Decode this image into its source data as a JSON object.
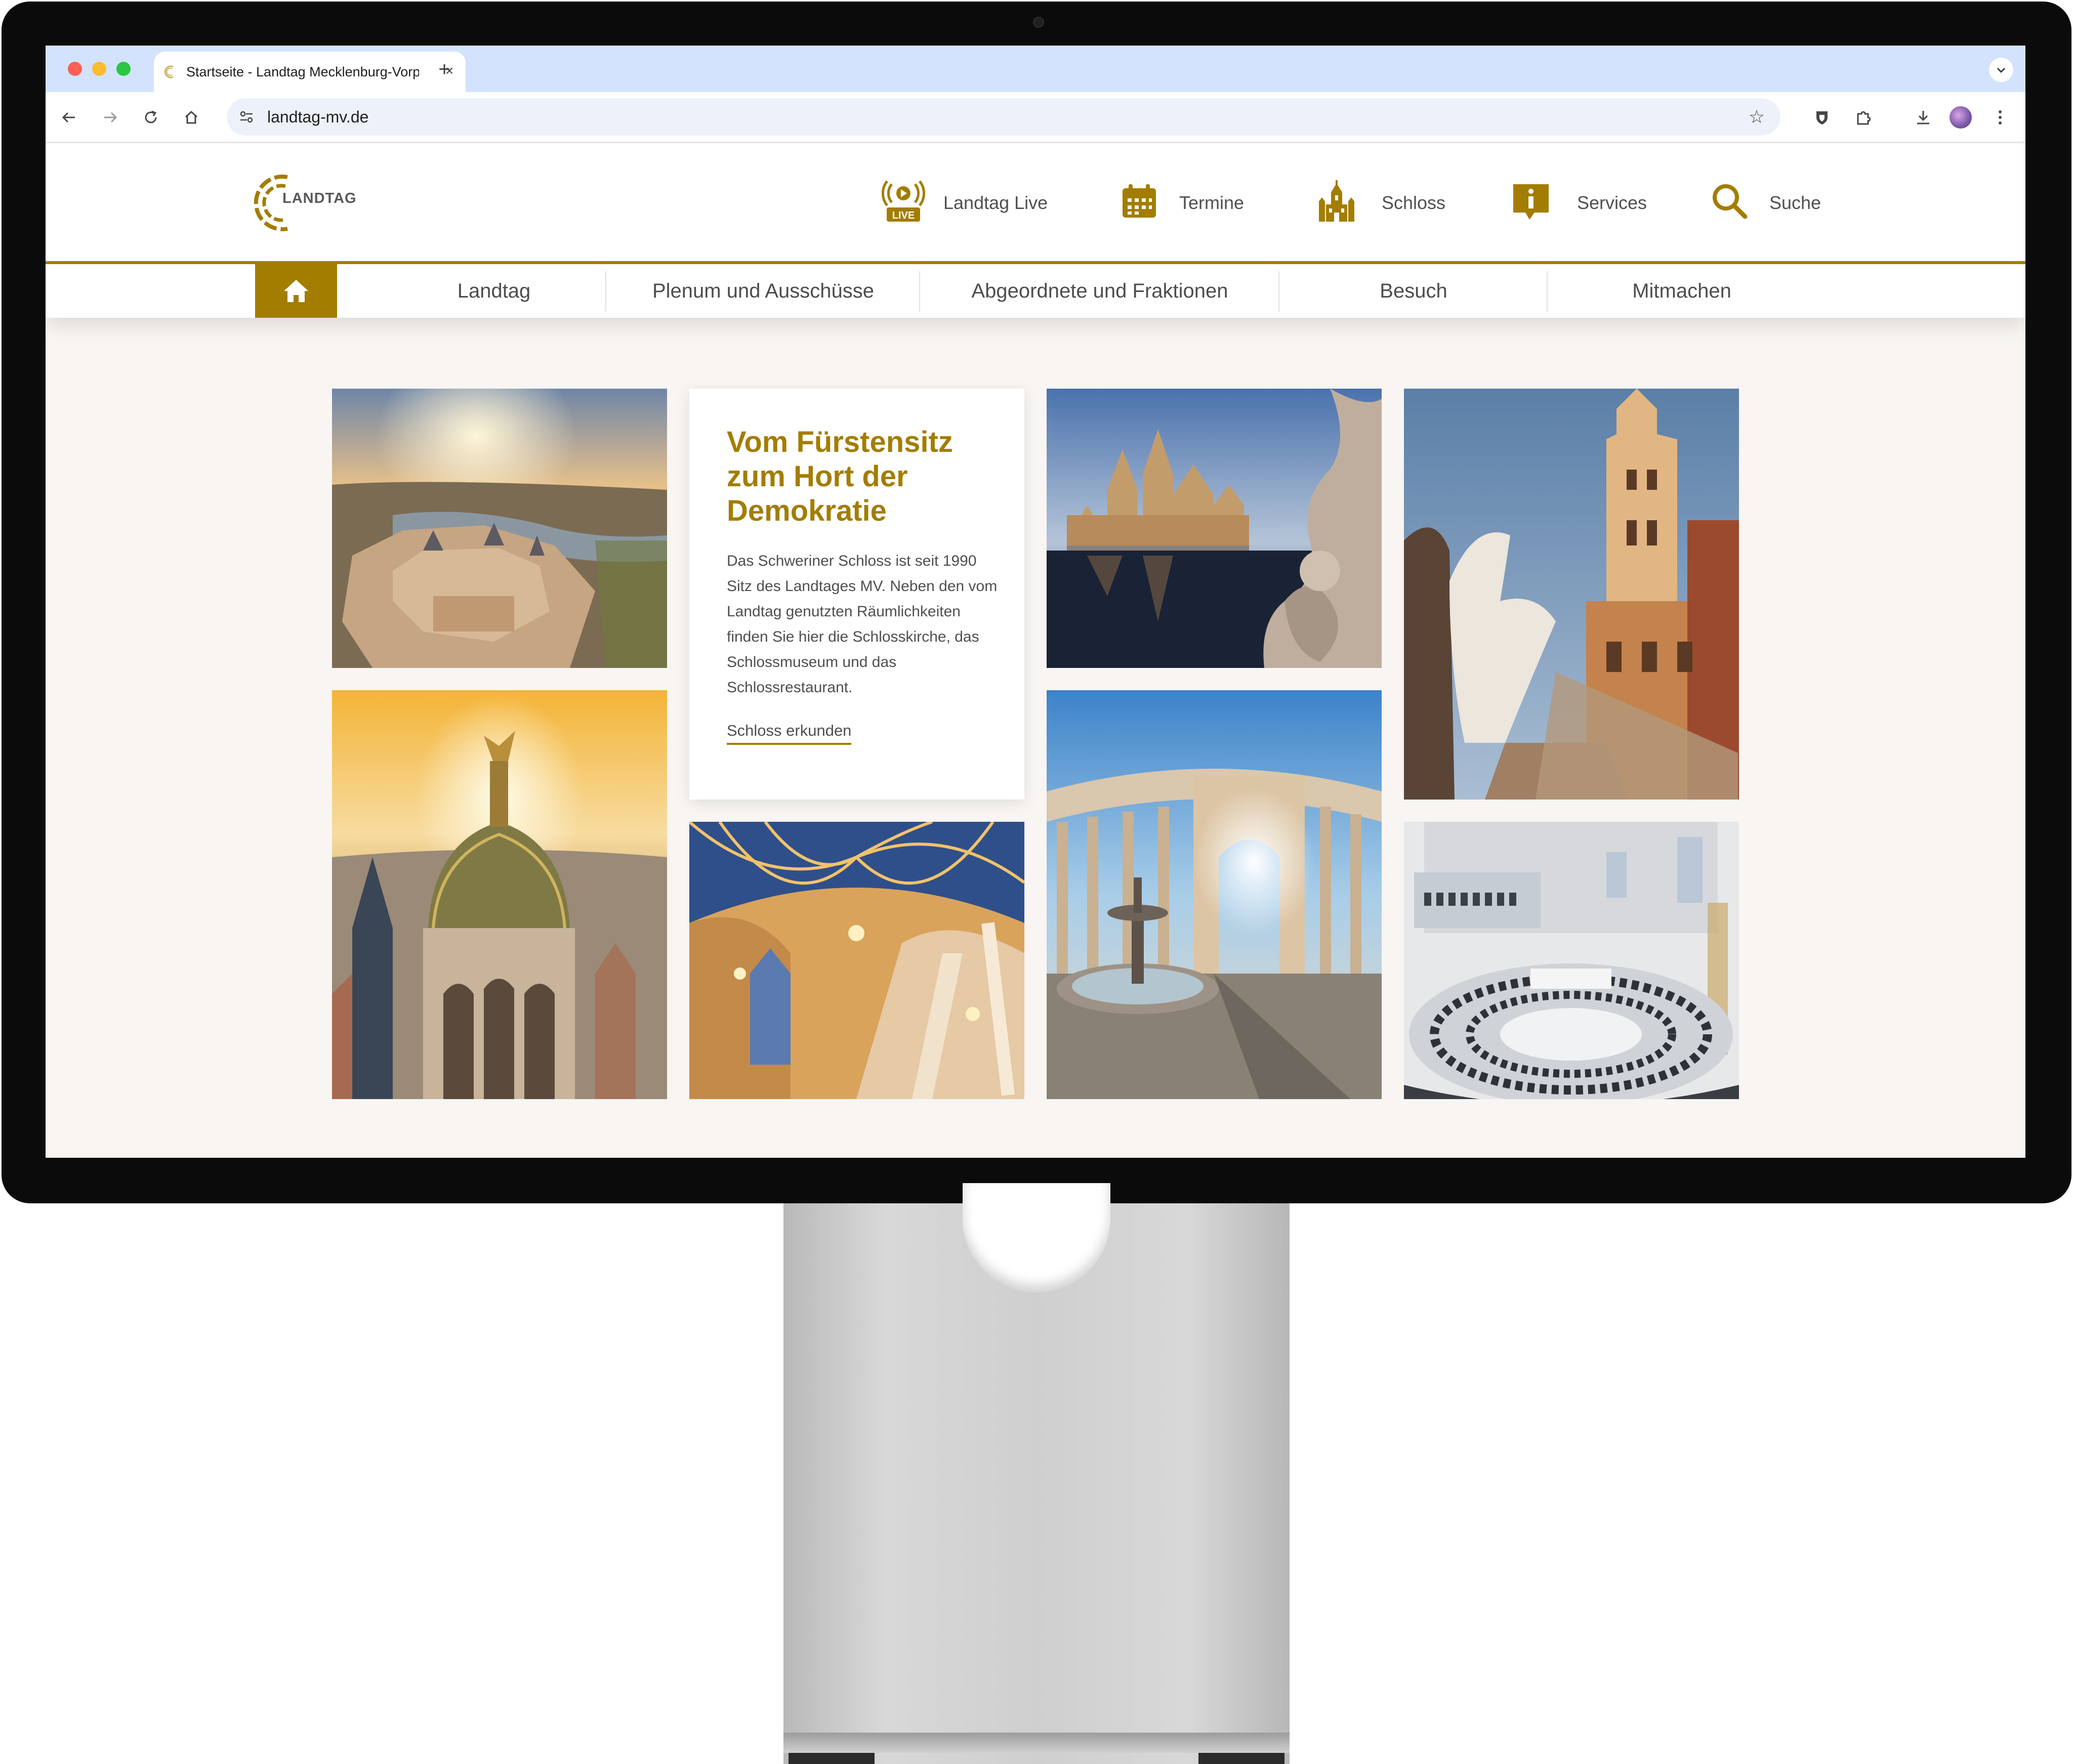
{
  "browser": {
    "tab_title": "Startseite - Landtag Mecklenburg-Vorpommern",
    "tab_close": "×",
    "new_tab": "+",
    "url": "landtag-mv.de"
  },
  "header": {
    "logo_text": "LANDTAG",
    "quick_links": [
      {
        "label": "Landtag Live",
        "icon": "live-broadcast-icon"
      },
      {
        "label": "Termine",
        "icon": "calendar-icon"
      },
      {
        "label": "Schloss",
        "icon": "castle-icon"
      },
      {
        "label": "Services",
        "icon": "info-icon"
      },
      {
        "label": "Suche",
        "icon": "search-icon"
      }
    ],
    "live_badge": "LIVE"
  },
  "nav": {
    "items": [
      {
        "label": "Landtag"
      },
      {
        "label": "Plenum und Ausschüsse"
      },
      {
        "label": "Abgeordnete und Fraktionen"
      },
      {
        "label": "Besuch"
      },
      {
        "label": "Mitmachen"
      }
    ]
  },
  "feature": {
    "title": "Vom Fürstensitz zum Hort der Demokratie",
    "text": "Das Schweriner Schloss ist seit 1990 Sitz des Landtages MV. Neben den vom Landtag genutzten Räumlichkeiten finden Sie hier die Schlosskirche, das Schlossmuseum und das Schlossrestaurant.",
    "link": "Schloss erkunden"
  },
  "colors": {
    "accent": "#a37d00",
    "page_bg": "#f8f5f3",
    "tabbar": "#d3e3fd"
  }
}
